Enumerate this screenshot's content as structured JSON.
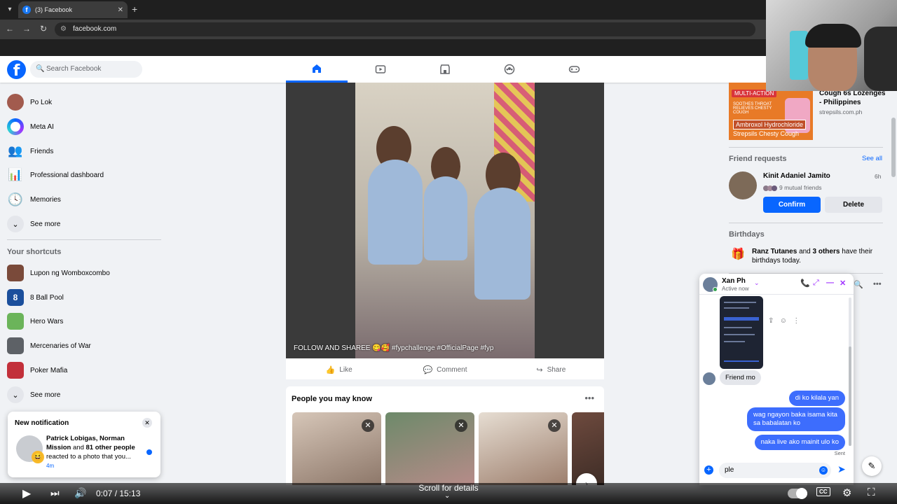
{
  "browser": {
    "tab_title": "(3) Facebook",
    "url": "facebook.com"
  },
  "fb": {
    "search_placeholder": "Search Facebook",
    "nav_tabs": [
      {
        "name": "home",
        "icon": "home-icon",
        "active": true
      },
      {
        "name": "video",
        "icon": "video-icon",
        "active": false
      },
      {
        "name": "marketplace",
        "icon": "marketplace-icon",
        "active": false
      },
      {
        "name": "groups",
        "icon": "groups-icon",
        "active": false
      },
      {
        "name": "gaming",
        "icon": "gaming-icon",
        "active": false
      }
    ]
  },
  "sidebar": {
    "items": [
      {
        "label": "Po Lok"
      },
      {
        "label": "Meta AI"
      },
      {
        "label": "Friends"
      },
      {
        "label": "Professional dashboard"
      },
      {
        "label": "Memories"
      },
      {
        "label": "See more"
      }
    ],
    "shortcuts_title": "Your shortcuts",
    "shortcuts": [
      {
        "label": "Lupon ng Womboxcombo"
      },
      {
        "label": "8 Ball Pool"
      },
      {
        "label": "Hero Wars"
      },
      {
        "label": "Mercenaries of War"
      },
      {
        "label": "Poker Mafia"
      },
      {
        "label": "See more"
      }
    ]
  },
  "notification": {
    "title": "New notification",
    "names": "Patrick Lobigas, Norman Mission",
    "connector": "and",
    "others": "81 other people",
    "rest": "reacted to a photo that you...",
    "time": "4m"
  },
  "post": {
    "caption": "FOLLOW AND SHAREE 😋🥰 #fypchallenge #OfficialPage #fyp",
    "actions": {
      "like": "Like",
      "comment": "Comment",
      "share": "Share"
    }
  },
  "pymk": {
    "title": "People you may know"
  },
  "ad": {
    "badge": "MULTI-ACTION",
    "small1": "SOOTHES THROAT",
    "small2": "RELIEVES CHESTY COUGH",
    "product": "Ambroxol Hydrochloride",
    "brand": "Strepsils Chesty Cough",
    "title": "Cough 6s Lozenges - Philippines",
    "url": "strepsils.com.ph"
  },
  "friend_requests": {
    "title": "Friend requests",
    "see_all": "See all",
    "name": "Kinit Adaniel Jamito",
    "time": "6h",
    "mutual": "9 mutual friends",
    "confirm": "Confirm",
    "delete": "Delete"
  },
  "birthdays": {
    "title": "Birthdays",
    "name": "Ranz Tutanes",
    "and": "and",
    "others": "3 others",
    "rest": "have their birthdays today."
  },
  "chat": {
    "name": "Xan Ph",
    "status": "Active now",
    "incoming": "Friend mo",
    "outgoing": [
      "di ko kilala yan",
      "wag ngayon baka isama kita sa babalatan ko",
      "naka live ako mainit ulo ko"
    ],
    "sent_label": "Sent",
    "input_value": "ple"
  },
  "player": {
    "time": "0:07 / 15:13",
    "scroll_hint": "Scroll for details"
  },
  "colors": {
    "fb_blue": "#0866ff",
    "messenger_purple": "#a033ff",
    "bubble_blue": "#3d6dfd"
  }
}
